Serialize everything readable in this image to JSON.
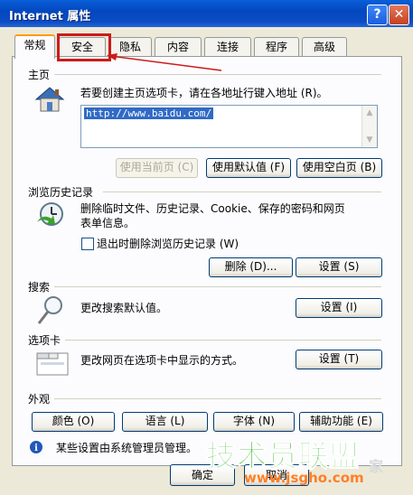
{
  "window": {
    "title": "Internet 属性",
    "help_glyph": "?",
    "close_glyph": "✕"
  },
  "tabs": [
    {
      "label": "常规",
      "active": true
    },
    {
      "label": "安全",
      "highlighted": true
    },
    {
      "label": "隐私"
    },
    {
      "label": "内容"
    },
    {
      "label": "连接"
    },
    {
      "label": "程序"
    },
    {
      "label": "高级"
    }
  ],
  "home": {
    "group_label": "主页",
    "instruction": "若要创建主页选项卡，请在各地址行键入地址 (R)。",
    "url": "http://www.baidu.com/",
    "use_current": "使用当前页 (C)",
    "use_default": "使用默认值 (F)",
    "use_blank": "使用空白页 (B)"
  },
  "history": {
    "group_label": "浏览历史记录",
    "desc_line1": "删除临时文件、历史记录、Cookie、保存的密码和网页",
    "desc_line2": "表单信息。",
    "checkbox_label": "退出时删除浏览历史记录 (W)",
    "delete_btn": "删除 (D)...",
    "settings_btn": "设置 (S)"
  },
  "search": {
    "group_label": "搜索",
    "desc": "更改搜索默认值。",
    "settings_btn": "设置 (I)"
  },
  "tabs_section": {
    "group_label": "选项卡",
    "desc": "更改网页在选项卡中显示的方式。",
    "settings_btn": "设置 (T)"
  },
  "appearance": {
    "group_label": "外观",
    "colors_btn": "颜色 (O)",
    "languages_btn": "语言 (L)",
    "fonts_btn": "字体 (N)",
    "accessibility_btn": "辅助功能 (E)"
  },
  "notice": {
    "text": "某些设置由系统管理员管理。",
    "info_glyph": "i"
  },
  "footer": {
    "ok_label": "确定",
    "cancel_label": "取消"
  },
  "watermark": {
    "brand": "技术员联盟",
    "url": "www.jsgho.com",
    "tail": "家"
  },
  "colors": {
    "title_bar": "#0348c0",
    "tab_highlight": "#cc1b1b",
    "arrow": "#cc1b1b",
    "watermark_green": "#2bb318",
    "watermark_orange": "#ff7f27"
  }
}
